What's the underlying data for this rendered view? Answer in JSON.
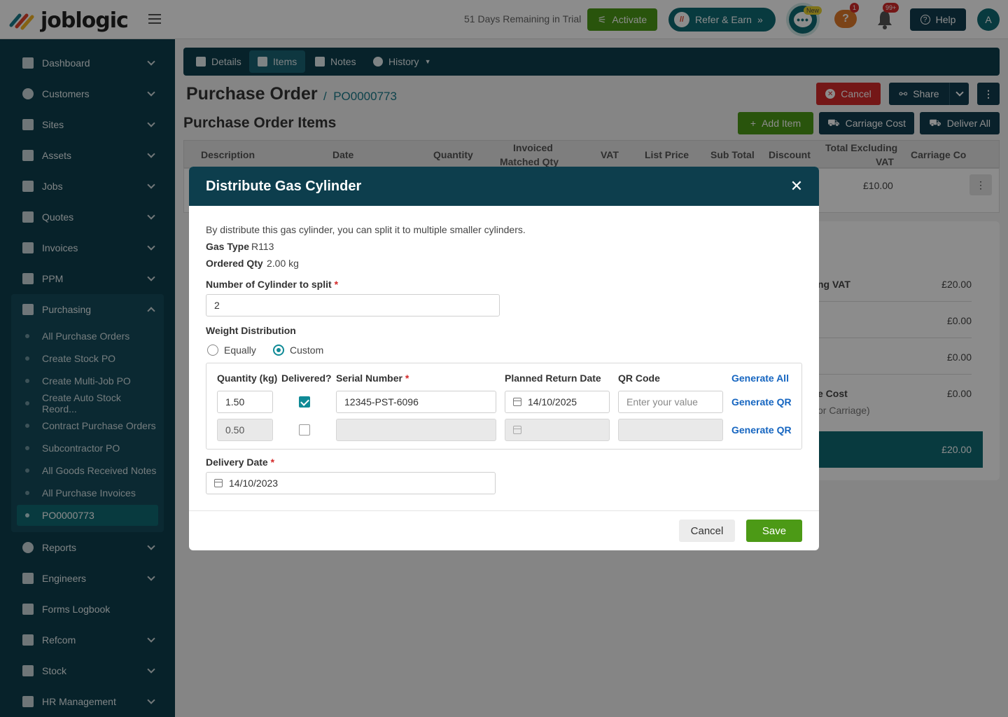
{
  "header": {
    "logo": "joblogic",
    "trial_text": "51 Days Remaining in Trial",
    "activate_label": "Activate",
    "refer_label": "Refer & Earn",
    "chat_badge": "New",
    "help_badge": "1",
    "notif_badge": "99+",
    "help_label": "Help",
    "avatar_initial": "A"
  },
  "sidebar": {
    "items": [
      {
        "label": "Dashboard",
        "icon": "dashboard-icon"
      },
      {
        "label": "Customers",
        "icon": "person-icon"
      },
      {
        "label": "Sites",
        "icon": "building-icon"
      },
      {
        "label": "Assets",
        "icon": "assets-icon"
      },
      {
        "label": "Jobs",
        "icon": "wrench-icon"
      },
      {
        "label": "Quotes",
        "icon": "clipboard-icon"
      },
      {
        "label": "Invoices",
        "icon": "card-icon"
      },
      {
        "label": "PPM",
        "icon": "calendar-check-icon"
      },
      {
        "label": "Purchasing",
        "icon": "document-icon"
      },
      {
        "label": "Reports",
        "icon": "pie-chart-icon"
      },
      {
        "label": "Engineers",
        "icon": "people-icon"
      },
      {
        "label": "Forms Logbook",
        "icon": "book-icon"
      },
      {
        "label": "Refcom",
        "icon": "cylinder-icon"
      },
      {
        "label": "Stock",
        "icon": "warehouse-icon"
      },
      {
        "label": "HR Management",
        "icon": "hr-icon"
      }
    ],
    "purchasing_sub": [
      "All Purchase Orders",
      "Create Stock PO",
      "Create Multi-Job PO",
      "Create Auto Stock Reord...",
      "Contract Purchase Orders",
      "Subcontractor PO",
      "All Goods Received Notes",
      "All Purchase Invoices",
      "PO0000773"
    ]
  },
  "tabs": {
    "details": "Details",
    "items": "Items",
    "notes": "Notes",
    "history": "History"
  },
  "page": {
    "title": "Purchase Order",
    "separator": "/",
    "po_number": "PO0000773",
    "cancel_label": "Cancel",
    "share_label": "Share",
    "section_title": "Purchase Order Items",
    "add_item_label": "Add Item",
    "carriage_label": "Carriage Cost",
    "deliver_all_label": "Deliver All"
  },
  "table": {
    "headers": {
      "description": "Description",
      "date": "Date",
      "quantity": "Quantity",
      "invoiced_line1": "Invoiced",
      "invoiced_line2": "Matched Qty",
      "vat": "VAT",
      "list_price": "List Price",
      "sub_total": "Sub Total",
      "discount": "Discount",
      "total_ex_line1": "Total Excluding",
      "total_ex_line2": "VAT",
      "carriage": "Carriage Co"
    },
    "row_total": "£10.00"
  },
  "summary": {
    "line1_label": "ng VAT",
    "line1_value": "£20.00",
    "line2_value": "£0.00",
    "line3_value": "£0.00",
    "line4_label": "e Cost",
    "line4_sub": "or Carriage)",
    "line4_value": "£0.00",
    "total_value": "£20.00"
  },
  "modal": {
    "title": "Distribute Gas Cylinder",
    "description": "By distribute this gas cylinder, you can split it to multiple smaller cylinders.",
    "gas_type_label": "Gas Type",
    "gas_type_value": "R113",
    "ordered_qty_label": "Ordered Qty",
    "ordered_qty_value": "2.00 kg",
    "num_cyl_label": "Number of Cylinder to split",
    "num_cyl_value": "2",
    "weight_label": "Weight Distribution",
    "option_equally": "Equally",
    "option_custom": "Custom",
    "selected_option": "Custom",
    "columns": {
      "quantity": "Quantity (kg)",
      "delivered": "Delivered?",
      "serial": "Serial Number",
      "return_date": "Planned Return Date",
      "qr": "QR Code",
      "generate_all": "Generate All"
    },
    "rows": [
      {
        "quantity": "1.50",
        "delivered": true,
        "serial": "12345-PST-6096",
        "return_date": "14/10/2025",
        "qr_placeholder": "Enter your value",
        "generate_label": "Generate QR"
      },
      {
        "quantity": "0.50",
        "delivered": false,
        "serial": "",
        "return_date": "",
        "qr_placeholder": "",
        "generate_label": "Generate QR"
      }
    ],
    "delivery_date_label": "Delivery Date",
    "delivery_date_value": "14/10/2023",
    "cancel_label": "Cancel",
    "save_label": "Save",
    "required_mark": "*"
  }
}
